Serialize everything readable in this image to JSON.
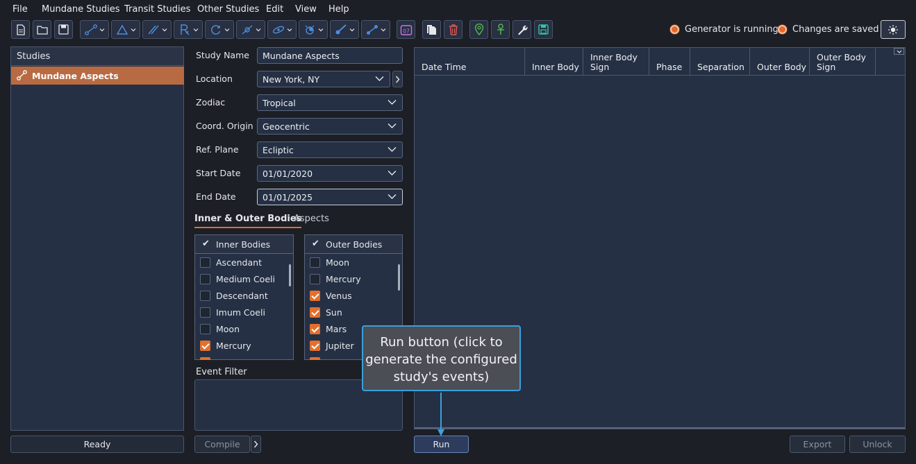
{
  "menu": [
    "File",
    "Mundane Studies",
    "Transit Studies",
    "Other Studies",
    "Edit",
    "View",
    "Help"
  ],
  "toolbar": {
    "icons": [
      "new-file-icon",
      "open-folder-icon",
      "save-icon",
      "aspect-line-icon",
      "triangle-icon",
      "parallel-lines-icon",
      "retrograde-icon",
      "cycle-icon",
      "node-icon",
      "orbit-icon",
      "eclipse-icon",
      "comet-icon",
      "connect-icon",
      "calendar-icon",
      "copy-icon",
      "delete-icon",
      "location-pin-icon",
      "ankh-icon",
      "wrench-icon",
      "save-layout-icon",
      "theme-toggle-icon"
    ],
    "calendar_label": "07"
  },
  "status": {
    "generator": "Generator is running",
    "changes": "Changes are saved"
  },
  "studies": {
    "header": "Studies",
    "items": [
      {
        "label": "Mundane Aspects"
      }
    ]
  },
  "form": {
    "study_name_label": "Study Name",
    "study_name_value": "Mundane Aspects",
    "location_label": "Location",
    "location_value": "New York, NY",
    "zodiac_label": "Zodiac",
    "zodiac_value": "Tropical",
    "coord_label": "Coord. Origin",
    "coord_value": "Geocentric",
    "plane_label": "Ref. Plane",
    "plane_value": "Ecliptic",
    "start_label": "Start Date",
    "start_value": "01/01/2020",
    "end_label": "End Date",
    "end_value": "01/01/2025"
  },
  "tabs": {
    "bodies": "Inner & Outer Bodies",
    "aspects": "Aspects"
  },
  "inner": {
    "header": "Inner Bodies",
    "items": [
      {
        "label": "Ascendant",
        "checked": false
      },
      {
        "label": "Medium Coeli",
        "checked": false
      },
      {
        "label": "Descendant",
        "checked": false
      },
      {
        "label": "Imum Coeli",
        "checked": false
      },
      {
        "label": "Moon",
        "checked": false
      },
      {
        "label": "Mercury",
        "checked": true
      }
    ]
  },
  "outer": {
    "header": "Outer Bodies",
    "items": [
      {
        "label": "Moon",
        "checked": false
      },
      {
        "label": "Mercury",
        "checked": false
      },
      {
        "label": "Venus",
        "checked": true
      },
      {
        "label": "Sun",
        "checked": true
      },
      {
        "label": "Mars",
        "checked": true
      },
      {
        "label": "Jupiter",
        "checked": true
      }
    ]
  },
  "event_filter_label": "Event Filter",
  "buttons": {
    "ready": "Ready",
    "compile": "Compile",
    "run": "Run",
    "export": "Export",
    "unlock": "Unlock"
  },
  "columns": [
    "Date Time",
    "Inner Body",
    "Inner Body Sign",
    "Phase",
    "Separation",
    "Outer Body",
    "Outer Body Sign"
  ],
  "callout": "Run button (click to generate the configured study's events)",
  "colors": {
    "accent": "#e46f2c",
    "selection": "#b86a42",
    "callout_border": "#3ba0dd"
  }
}
